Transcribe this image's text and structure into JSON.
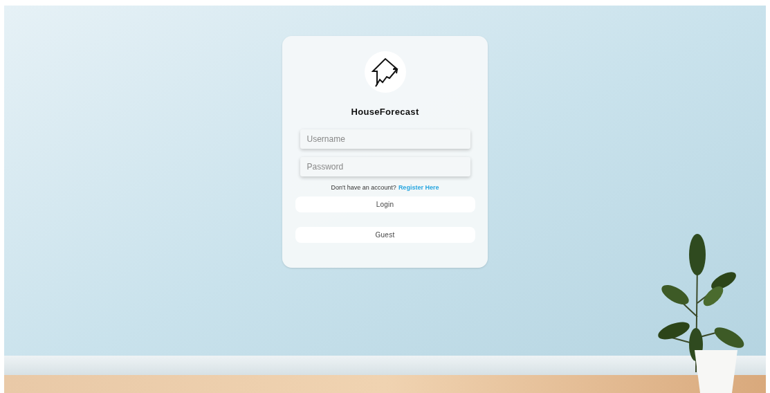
{
  "brand": {
    "name": "HouseForecast"
  },
  "fields": [
    {
      "placeholder": "Username"
    },
    {
      "placeholder": "Password"
    }
  ],
  "register_prompt": {
    "text": "Don't have an account?",
    "link": "Register Here"
  },
  "buttons": [
    {
      "label": "Login"
    },
    {
      "label": "Guest"
    }
  ]
}
